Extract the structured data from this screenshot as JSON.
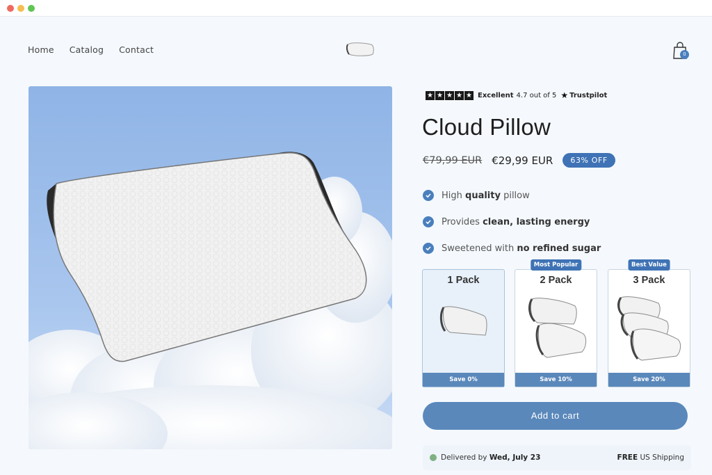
{
  "header": {
    "nav": [
      "Home",
      "Catalog",
      "Contact"
    ],
    "cart_count": "0"
  },
  "product": {
    "rating": {
      "label": "Excellent",
      "score_text": "4.7 out of 5",
      "provider": "Trustpilot",
      "stars": 5
    },
    "title": "Cloud Pillow",
    "old_price": "€79,99 EUR",
    "new_price": "€29,99 EUR",
    "discount": "63% OFF",
    "benefits": [
      {
        "pre": "High ",
        "bold": "quality",
        "post": " pillow"
      },
      {
        "pre": "Provides ",
        "bold": "clean, lasting energy",
        "post": ""
      },
      {
        "pre": "Sweetened with ",
        "bold": "no refined sugar",
        "post": ""
      }
    ],
    "packs": [
      {
        "title": "1 Pack",
        "save": "Save 0%",
        "badge": "",
        "selected": true
      },
      {
        "title": "2 Pack",
        "save": "Save 10%",
        "badge": "Most Popular",
        "selected": false
      },
      {
        "title": "3 Pack",
        "save": "Save 20%",
        "badge": "Best Value",
        "selected": false
      }
    ],
    "add_to_cart": "Add to cart",
    "delivery": {
      "pre": "Delivered by ",
      "date": "Wed, July 23",
      "shipping_bold": "FREE",
      "shipping_rest": " US Shipping"
    }
  },
  "colors": {
    "accent": "#3f73b5",
    "button": "#5a88bb",
    "background": "#f5f9fd"
  }
}
